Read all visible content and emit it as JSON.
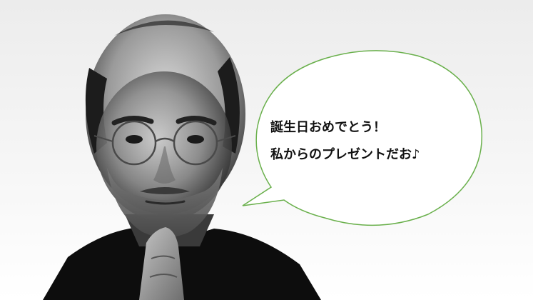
{
  "scene": {
    "subject": "portrait-photo",
    "style": "black-and-white"
  },
  "speech_bubble": {
    "line1": "誕生日おめでとう！",
    "line2": "私からのプレゼントだお♪",
    "border_color": "#6ab04c",
    "fill_color": "#ffffff"
  },
  "colors": {
    "background": "#f2f2f2",
    "shirt": "#0d0d0d"
  }
}
